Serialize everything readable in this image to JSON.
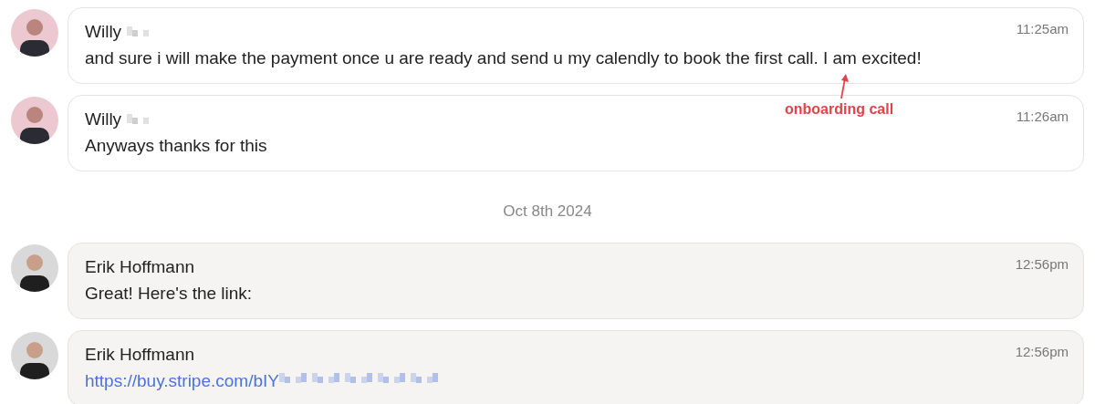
{
  "feed": [
    {
      "kind": "contact_message",
      "author": "Willy",
      "author_redacted": true,
      "time": "11:25am",
      "text": "and sure i will make the payment once u are ready and send u my calendly to book the first call. I am excited!"
    },
    {
      "kind": "contact_message",
      "author": "Willy",
      "author_redacted": true,
      "time": "11:26am",
      "text": "Anyways thanks for this"
    },
    {
      "kind": "date",
      "text": "Oct 8th 2024"
    },
    {
      "kind": "own_message",
      "author": "Erik Hoffmann",
      "time": "12:56pm",
      "text": "Great! Here's the link:"
    },
    {
      "kind": "own_message",
      "author": "Erik Hoffmann",
      "time": "12:56pm",
      "link": "https://buy.stripe.com/bIY",
      "link_redacted": true
    }
  ],
  "annotation": {
    "label": "onboarding call"
  }
}
